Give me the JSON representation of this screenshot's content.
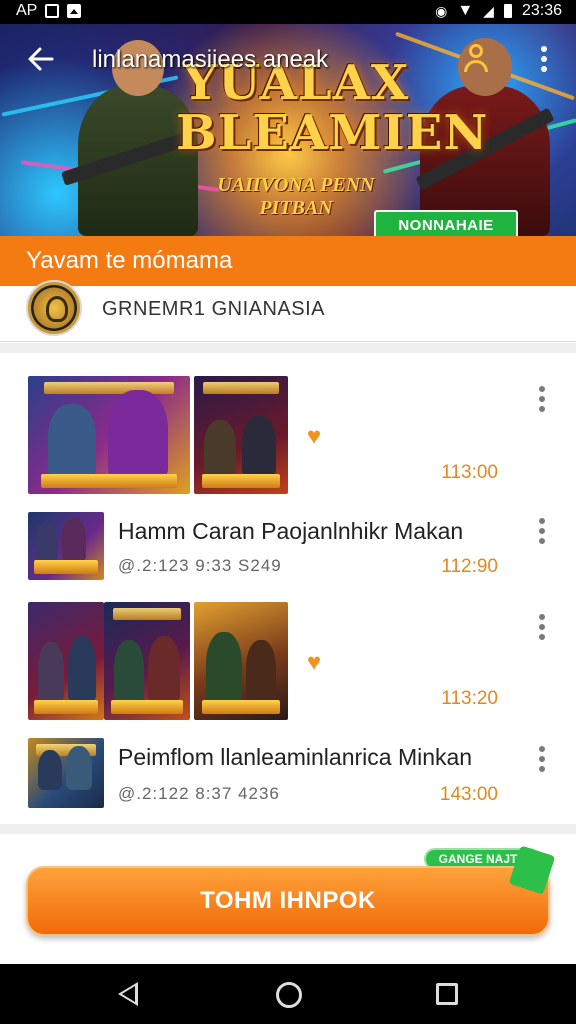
{
  "status_bar": {
    "left_text": "AP",
    "time": "23:36",
    "icons": [
      "image-icon",
      "download-icon",
      "vibrate-icon",
      "wifi-icon",
      "signal-icon",
      "battery-icon"
    ]
  },
  "header": {
    "title": "linlanamasiiees aneak",
    "back_icon": "arrow-left-icon",
    "user_icon": "user-icon",
    "menu_icon": "more-vert-icon"
  },
  "banner": {
    "title_line1": "YUALAX",
    "title_line2": "BLEAMIEN",
    "subtitle": "UAIIVONA PENN PITBAN",
    "button_label": "NONNAHAIE"
  },
  "section_title": "Yavam te mómama",
  "channel": {
    "name": "GRNEMR1 GNIANASIA"
  },
  "items": [
    {
      "type": "double",
      "price": "113:00"
    },
    {
      "type": "single",
      "title": "Hamm Caran Paojanlnhikr Makan",
      "meta": "@.2:123  9:33  S249",
      "price": "112:90"
    },
    {
      "type": "triple",
      "price": "113:20"
    },
    {
      "type": "single",
      "title": "Peimflom llanleaminlanrica Minkan",
      "meta": "@.2:122  8:37  4236",
      "price": "143:00"
    }
  ],
  "promo_tag": "GANGE NAJTE",
  "cta_label": "TOHM IHNPOK",
  "colors": {
    "accent_orange": "#f47a12",
    "price_orange": "#e08a1e",
    "banner_green": "#1fb340"
  }
}
